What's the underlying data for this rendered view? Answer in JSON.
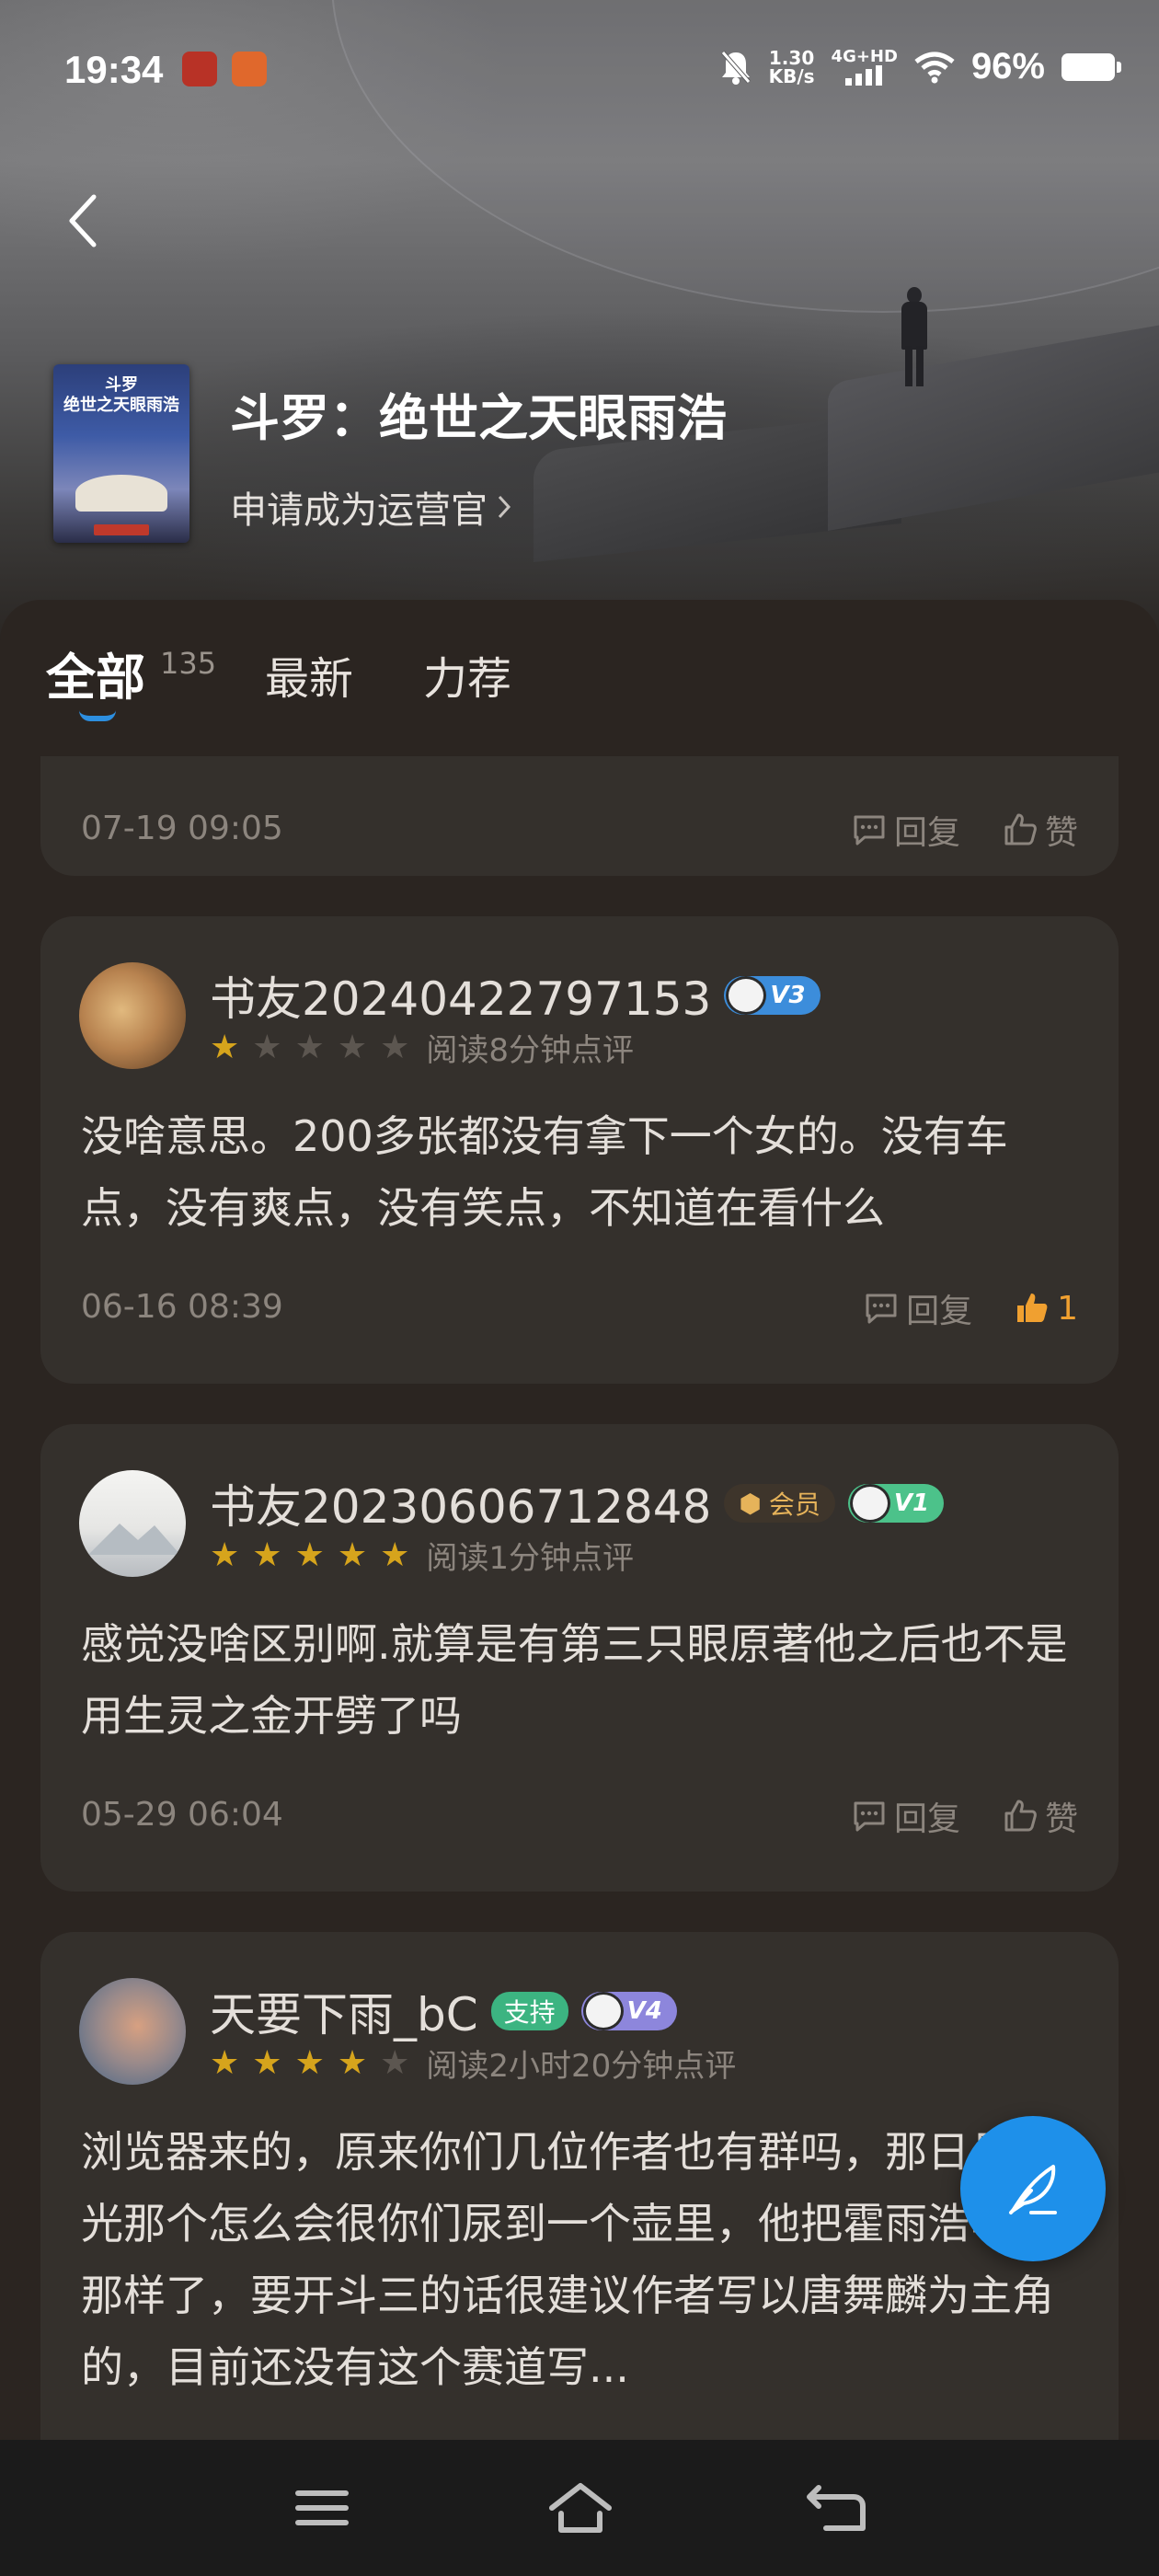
{
  "status_bar": {
    "time": "19:34",
    "net_speed_value": "1.30",
    "net_speed_unit": "KB/s",
    "network": "4G+HD",
    "battery": "96%"
  },
  "book": {
    "title": "斗罗：绝世之天眼雨浩",
    "cover_text": "斗罗\n绝世之天眼雨浩",
    "apply_link": "申请成为运营官"
  },
  "tabs": {
    "all": "全部",
    "all_count": "135",
    "latest": "最新",
    "recommend": "力荐"
  },
  "comments": [
    {
      "date": "07-19 09:05",
      "reply_label": "回复",
      "like_label": "赞"
    },
    {
      "username": "书友20240422797153",
      "level": "V3",
      "stars": 1,
      "meta": "阅读8分钟点评",
      "content": "没啥意思。200多张都没有拿下一个女的。没有车点，没有爽点，没有笑点，不知道在看什么",
      "date": "06-16 08:39",
      "reply_label": "回复",
      "like_label": "1"
    },
    {
      "username": "书友20230606712848",
      "vip": "会员",
      "level": "V1",
      "stars": 5,
      "meta": "阅读1分钟点评",
      "content": "感觉没啥区别啊.就算是有第三只眼原著他之后也不是用生灵之金开劈了吗",
      "date": "05-29 06:04",
      "reply_label": "回复",
      "like_label": "赞"
    },
    {
      "username": "天要下雨_bC",
      "support": "支持",
      "level": "V4",
      "stars": 4,
      "meta": "阅读2小时20分钟点评",
      "content": "浏览器来的，原来你们几位作者也有群吗，那日月荣光那个怎么会很你们尿到一个壶里，他把霍雨浩写成那样了，要开斗三的话很建议作者写以唐舞麟为主角的，目前还没有这个赛道写..."
    }
  ],
  "colors": {
    "accent": "#1e90ea",
    "star_on": "#d6a41c",
    "liked": "#f0a030"
  }
}
